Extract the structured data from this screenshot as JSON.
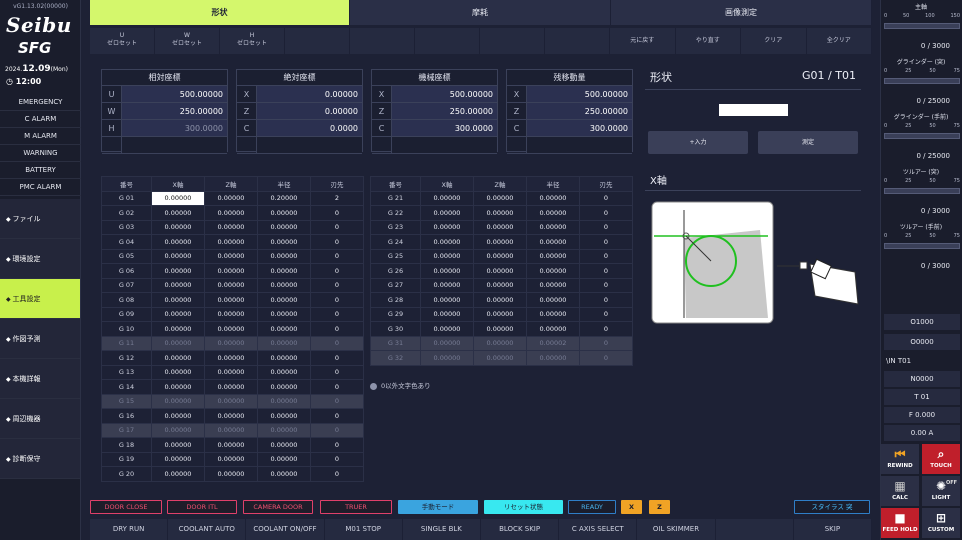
{
  "header": {
    "version": "vG1.13.02(00000)",
    "logo_top": "Seibu",
    "logo_bottom": "SFG",
    "date_year": "2024.",
    "date_day": "12.09",
    "date_dow": "(Mon)",
    "time": "12:00"
  },
  "alarms": [
    "EMERGENCY",
    "C ALARM",
    "M ALARM",
    "WARNING",
    "BATTERY",
    "PMC ALARM"
  ],
  "sidebar": [
    {
      "label": "ファイル",
      "icon": "file-icon"
    },
    {
      "label": "環境設定",
      "icon": "wrench-icon"
    },
    {
      "label": "工具設定",
      "icon": "tool-icon",
      "active": true
    },
    {
      "label": "作図予測",
      "icon": "drawing-icon"
    },
    {
      "label": "本機詳報",
      "icon": "machine-icon"
    },
    {
      "label": "周辺機器",
      "icon": "gear-icon"
    },
    {
      "label": "診断保守",
      "icon": "check-icon"
    }
  ],
  "tabs": [
    "形状",
    "摩耗",
    "画像測定"
  ],
  "tool_row": {
    "left": [
      [
        "U",
        "ゼロセット"
      ],
      [
        "W",
        "ゼロセット"
      ],
      [
        "H",
        "ゼロセット"
      ]
    ],
    "right": [
      "元に戻す",
      "やり直す",
      "クリア",
      "全クリア"
    ]
  },
  "coords": [
    {
      "title": "相対座標",
      "rows": [
        [
          "U",
          "500.00000"
        ],
        [
          "W",
          "250.00000"
        ],
        [
          "H",
          "300.0000"
        ]
      ]
    },
    {
      "title": "絶対座標",
      "rows": [
        [
          "X",
          "0.00000"
        ],
        [
          "Z",
          "0.00000"
        ],
        [
          "C",
          "0.0000"
        ]
      ]
    },
    {
      "title": "機械座標",
      "rows": [
        [
          "X",
          "500.00000"
        ],
        [
          "Z",
          "250.00000"
        ],
        [
          "C",
          "300.0000"
        ]
      ]
    },
    {
      "title": "残移動量",
      "rows": [
        [
          "X",
          "500.00000"
        ],
        [
          "Z",
          "250.00000"
        ],
        [
          "C",
          "300.0000"
        ]
      ]
    }
  ],
  "table_headers": [
    "番号",
    "X軸",
    "Z軸",
    "半径",
    "刃先"
  ],
  "offsets_left": [
    [
      "G 01",
      "0.00000",
      "0.00000",
      "0.20000",
      "2"
    ],
    [
      "G 02",
      "0.00000",
      "0.00000",
      "0.00000",
      "0"
    ],
    [
      "G 03",
      "0.00000",
      "0.00000",
      "0.00000",
      "0"
    ],
    [
      "G 04",
      "0.00000",
      "0.00000",
      "0.00000",
      "0"
    ],
    [
      "G 05",
      "0.00000",
      "0.00000",
      "0.00000",
      "0"
    ],
    [
      "G 06",
      "0.00000",
      "0.00000",
      "0.00000",
      "0"
    ],
    [
      "G 07",
      "0.00000",
      "0.00000",
      "0.00000",
      "0"
    ],
    [
      "G 08",
      "0.00000",
      "0.00000",
      "0.00000",
      "0"
    ],
    [
      "G 09",
      "0.00000",
      "0.00000",
      "0.00000",
      "0"
    ],
    [
      "G 10",
      "0.00000",
      "0.00000",
      "0.00000",
      "0"
    ],
    [
      "G 11",
      "0.00000",
      "0.00000",
      "0.00000",
      "0"
    ],
    [
      "G 12",
      "0.00000",
      "0.00000",
      "0.00000",
      "0"
    ],
    [
      "G 13",
      "0.00000",
      "0.00000",
      "0.00000",
      "0"
    ],
    [
      "G 14",
      "0.00000",
      "0.00000",
      "0.00000",
      "0"
    ],
    [
      "G 15",
      "0.00000",
      "0.00000",
      "0.00000",
      "0"
    ],
    [
      "G 16",
      "0.00000",
      "0.00000",
      "0.00000",
      "0"
    ],
    [
      "G 17",
      "0.00000",
      "0.00000",
      "0.00000",
      "0"
    ],
    [
      "G 18",
      "0.00000",
      "0.00000",
      "0.00000",
      "0"
    ],
    [
      "G 19",
      "0.00000",
      "0.00000",
      "0.00000",
      "0"
    ],
    [
      "G 20",
      "0.00000",
      "0.00000",
      "0.00000",
      "0"
    ]
  ],
  "offsets_right": [
    [
      "G 21",
      "0.00000",
      "0.00000",
      "0.00000",
      "0"
    ],
    [
      "G 22",
      "0.00000",
      "0.00000",
      "0.00000",
      "0"
    ],
    [
      "G 23",
      "0.00000",
      "0.00000",
      "0.00000",
      "0"
    ],
    [
      "G 24",
      "0.00000",
      "0.00000",
      "0.00000",
      "0"
    ],
    [
      "G 25",
      "0.00000",
      "0.00000",
      "0.00000",
      "0"
    ],
    [
      "G 26",
      "0.00000",
      "0.00000",
      "0.00000",
      "0"
    ],
    [
      "G 27",
      "0.00000",
      "0.00000",
      "0.00000",
      "0"
    ],
    [
      "G 28",
      "0.00000",
      "0.00000",
      "0.00000",
      "0"
    ],
    [
      "G 29",
      "0.00000",
      "0.00000",
      "0.00000",
      "0"
    ],
    [
      "G 30",
      "0.00000",
      "0.00000",
      "0.00000",
      "0"
    ],
    [
      "G 31",
      "0.00000",
      "0.00000",
      "0.00002",
      "0"
    ],
    [
      "G 32",
      "0.00000",
      "0.00000",
      "0.00000",
      "0"
    ]
  ],
  "dim_left_rows": [
    10,
    14,
    16
  ],
  "dim_right_rows": [
    10,
    11
  ],
  "checkbox_label": "0以外文字色あり",
  "shape": {
    "title": "形状",
    "code": "G01 / T01",
    "input_button": "+入力",
    "measure_button": "測定",
    "axis_label": "X軸"
  },
  "right": {
    "spindle": {
      "label": "主軸",
      "scale": [
        "0",
        "50",
        "100",
        "150"
      ],
      "value": "0 / 3000"
    },
    "grinder1": {
      "label": "グラインダー (突)",
      "scale": [
        "0",
        "25",
        "50",
        "75"
      ],
      "value": "0 / 25000"
    },
    "grinder2": {
      "label": "グラインダー (手前)",
      "scale": [
        "0",
        "25",
        "50",
        "75"
      ],
      "value": "0 / 25000"
    },
    "turret1": {
      "label": "ツルアー (突)",
      "scale": [
        "0",
        "25",
        "50",
        "75"
      ],
      "value": "0 / 3000"
    },
    "turret2": {
      "label": "ツルアー (手前)",
      "scale": [
        "0",
        "25",
        "50",
        "75"
      ],
      "value": "0 / 3000"
    },
    "prog1": "O1000",
    "prog2": "O0000",
    "line_label": "\\IN T01",
    "n_val": "N0000",
    "t_val": "T 01",
    "f_val": "F 0.000",
    "a_val": "0.00 A",
    "btns": [
      "REWIND",
      "TOUCH",
      "CALC",
      "LIGHT",
      "FEED HOLD",
      "CUSTOM"
    ],
    "light_state": "OFF"
  },
  "indicators": [
    "DOOR CLOSE",
    "DOOR ITL",
    "CAMERA DOOR",
    "TRUER",
    "手動モード",
    "リセット状態",
    "READY",
    "X",
    "Z",
    "スタイラス 突"
  ],
  "bottom": [
    "DRY RUN",
    "COOLANT AUTO",
    "COOLANT ON/OFF",
    "M01 STOP",
    "SINGLE BLK",
    "BLOCK SKIP",
    "C AXIS SELECT",
    "OIL SKIMMER",
    "",
    "SKIP"
  ]
}
